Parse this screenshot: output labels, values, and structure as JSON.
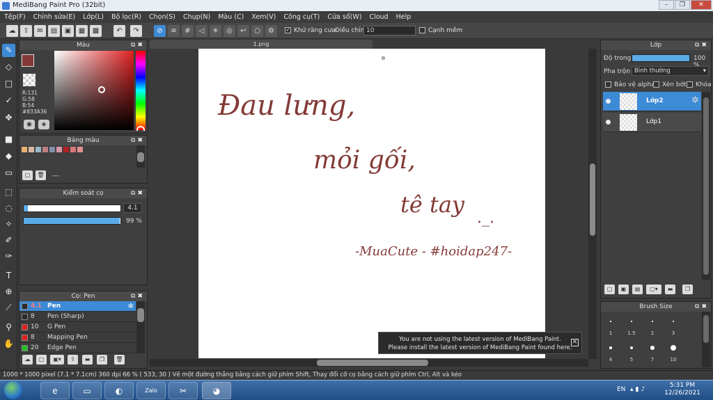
{
  "window": {
    "title": "MediBang Paint Pro (32bit)"
  },
  "menu": [
    "Tệp(F)",
    "Chỉnh sửa(E)",
    "Lớp(L)",
    "Bộ lọc(R)",
    "Chọn(S)",
    "Chụp(N)",
    "Màu (C)",
    "Xem(V)",
    "Công cụ(T)",
    "Cửa sổ(W)",
    "Cloud",
    "Help"
  ],
  "toolbar": {
    "antialias_label": "Khử răng cưa",
    "correction_label": "Điều chỉnh",
    "correction_value": "10",
    "smooth_label": "Cạnh mềm"
  },
  "color_panel": {
    "title": "Màu",
    "r": "R:131",
    "g": "G:58",
    "b": "B:54",
    "hex": "#833A36",
    "color": "#833A36"
  },
  "palette_panel": {
    "title": "Bảng màu",
    "swatches": [
      "#e8b070",
      "#d8b8a0",
      "#98b8c8",
      "#c08080",
      "#8090a8",
      "#d898a8",
      "#b02020",
      "#d87878",
      "#e09090"
    ],
    "dash": "---"
  },
  "brush_control": {
    "title": "Kiểm soát cọ",
    "size": "4.1",
    "size_fraction": 0.04,
    "opacity": "99 %",
    "opacity_fraction": 0.99
  },
  "brush_panel": {
    "title": "Cọ: Pen",
    "brushes": [
      {
        "size": "4.1",
        "name": "Pen",
        "color": "#2a2a2a"
      },
      {
        "size": "8",
        "name": "Pen (Sharp)",
        "color": "#2a2a2a"
      },
      {
        "size": "10",
        "name": "G Pen",
        "color": "#e02020"
      },
      {
        "size": "8",
        "name": "Mapping Pen",
        "color": "#e02020"
      },
      {
        "size": "20",
        "name": "Edge Pen",
        "color": "#20c020"
      }
    ]
  },
  "canvas": {
    "tab": "1.png",
    "handwriting": {
      "line1": "Đau lưng,",
      "line2": "mỏi gối,",
      "line3": "tê tay",
      "line3b": "._.",
      "signature": "-MuaCute - #hoidap247-"
    }
  },
  "notice": {
    "line1": "You are not using the latest version of MediBang Paint.",
    "line2": "Please install the latest version of MediBang Paint found here."
  },
  "layer_panel": {
    "title": "Lớp",
    "opacity_label": "Độ trong",
    "opacity_value": "100 %",
    "blend_label": "Pha trộn",
    "blend_value": "Bình thường",
    "protect_alpha": "Bảo vệ alpha",
    "clipping": "Xén bớt",
    "lock": "Khóa",
    "layers": [
      {
        "name": "Lớp2",
        "selected": true
      },
      {
        "name": "Lớp1",
        "selected": false
      }
    ]
  },
  "brush_size_panel": {
    "title": "Brush Size",
    "row1": [
      "1",
      "1.5",
      "2",
      "3"
    ],
    "row2": [
      "4",
      "5",
      "7",
      "10"
    ]
  },
  "status": {
    "text": "1000 * 1000 pixel   (7.1 * 7.1cm)   360 dpi   66 %   ( 533, 30 )   Vẽ một đường thẳng bằng cách giữ phím Shift, Thay đổi cỡ cọ bằng cách giữ phím Ctrl, Alt và kéo"
  },
  "taskbar": {
    "lang": "EN",
    "time": "5:31 PM",
    "date": "12/26/2021",
    "zalo": "Zalo"
  }
}
